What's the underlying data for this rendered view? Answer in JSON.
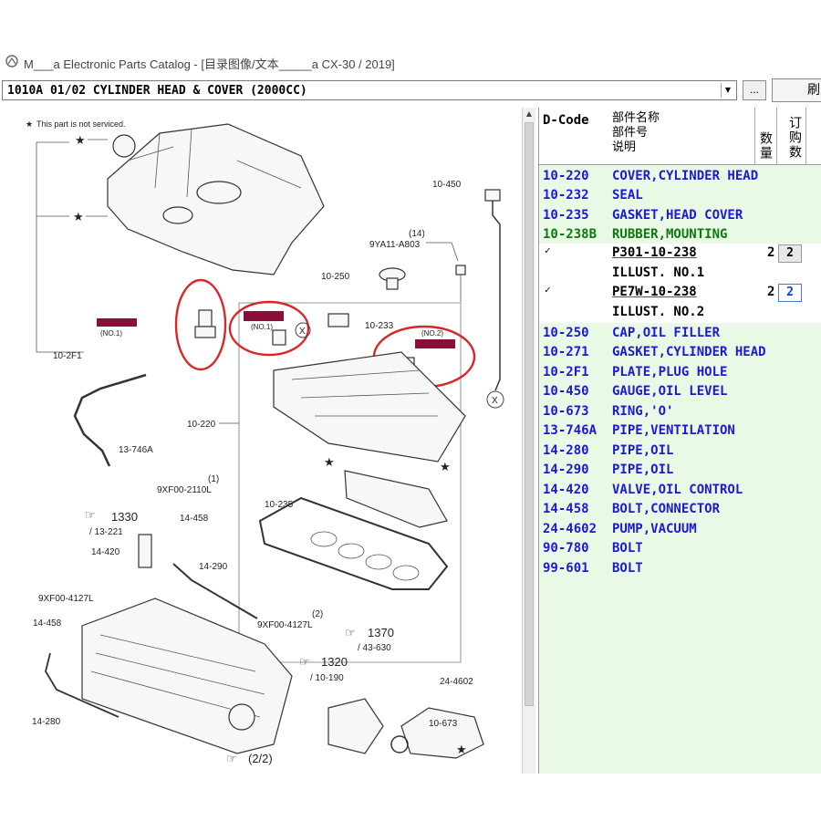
{
  "window": {
    "title": "M___a Electronic Parts Catalog - [目录图像/文本_____a CX-30 / 2019]"
  },
  "toolbar": {
    "section_select_value": "1010A 01/02 CYLINDER HEAD & COVER (2000CC)",
    "more_button_label": "...",
    "extra_button_label": "刷"
  },
  "diagram": {
    "note": "This part is not serviced.",
    "labels": {
      "l_10_2f1": "10-2F1",
      "l_10_450": "10-450",
      "l_10_238_qty": "(14)",
      "l_9ya11": "9YA11-A803",
      "l_10_250": "10-250",
      "l_10_233": "10-233",
      "l_no2": "(NO.2)",
      "l_no1_a": "(NO.1)",
      "l_no1_b": "(NO.1)",
      "l_10_220": "10-220",
      "l_13_746a": "13-746A",
      "l_1330": "1330",
      "l_13_221": "/ 13-221",
      "l_9xf00_2110": "9XF00-2110L",
      "l_q1": "(1)",
      "l_14_458_a": "14-458",
      "l_14_420": "14-420",
      "l_14_290": "14-290",
      "l_10_235": "10-235",
      "l_9xf00_4127_a": "9XF00-4127L",
      "l_q2a": "(2)",
      "l_q2b": "(2)",
      "l_9xf00_4127_b": "9XF00-4127L",
      "l_14_458_b": "14-458",
      "l_1370": "1370",
      "l_43_630": "/ 43-630",
      "l_1320": "1320",
      "l_10_190": "/ 10-190",
      "l_24_4602": "24-4602",
      "l_14_280": "14-280",
      "l_10_673": "10-673",
      "l_page": "(2/2)",
      "marker_x": "X"
    }
  },
  "parts": {
    "headers": {
      "code": "D-Code",
      "name_line1": "部件名称",
      "name_line2": "部件号",
      "name_line3": "说明",
      "qty": "数量",
      "order": "订购数"
    },
    "rows": [
      {
        "code": "10-220",
        "name": "COVER,CYLINDER HEAD"
      },
      {
        "code": "10-232",
        "name": "SEAL"
      },
      {
        "code": "10-235",
        "name": "GASKET,HEAD COVER"
      },
      {
        "code": "10-238B",
        "name": "RUBBER,MOUNTING"
      }
    ],
    "subrows": [
      {
        "check": "✓",
        "part_no": "P301-10-238",
        "qty": "2",
        "order": "2",
        "illust": "ILLUST. NO.1"
      },
      {
        "check": "✓",
        "part_no": "PE7W-10-238",
        "qty": "2",
        "order": "2",
        "illust": "ILLUST. NO.2"
      }
    ],
    "rows2": [
      {
        "code": "10-250",
        "name": "CAP,OIL FILLER"
      },
      {
        "code": "10-271",
        "name": "GASKET,CYLINDER HEAD"
      },
      {
        "code": "10-2F1",
        "name": "PLATE,PLUG HOLE"
      },
      {
        "code": "10-450",
        "name": "GAUGE,OIL LEVEL"
      },
      {
        "code": "10-673",
        "name": "RING,'O'"
      },
      {
        "code": "13-746A",
        "name": "PIPE,VENTILATION"
      },
      {
        "code": "14-280",
        "name": "PIPE,OIL"
      },
      {
        "code": "14-290",
        "name": "PIPE,OIL"
      },
      {
        "code": "14-420",
        "name": "VALVE,OIL CONTROL"
      },
      {
        "code": "14-458",
        "name": "BOLT,CONNECTOR"
      },
      {
        "code": "24-4602",
        "name": "PUMP,VACUUM"
      },
      {
        "code": "90-780",
        "name": "BOLT"
      },
      {
        "code": "99-601",
        "name": "BOLT"
      }
    ]
  }
}
